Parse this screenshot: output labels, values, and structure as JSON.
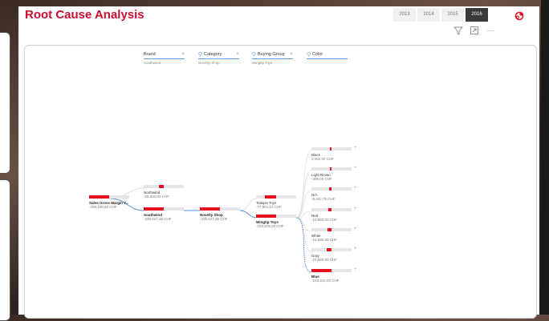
{
  "app": {
    "title": "Root Cause Analysis"
  },
  "years": [
    "2013",
    "2014",
    "2015",
    "2016"
  ],
  "active_year": "2016",
  "toolbar": {
    "filter_icon": "filter-icon",
    "focus_icon": "focus-mode-icon",
    "more_icon": "more-options-icon",
    "more_label": "···"
  },
  "fields": [
    {
      "label": "Brand",
      "value": "Southwind",
      "icon": "",
      "close": "×"
    },
    {
      "label": "Category",
      "value": "Novelty Shop",
      "icon": "lightbulb-icon",
      "close": "×"
    },
    {
      "label": "Buying Group",
      "value": "Wingtip Toys",
      "icon": "lightbulb-icon",
      "close": "×"
    },
    {
      "label": "Color",
      "value": "",
      "icon": "lightbulb-icon",
      "close": ""
    }
  ],
  "tree": {
    "root": {
      "name": "Sales Gross Margin Y...",
      "value": "-268,159,65 CHF",
      "fill": 0.5
    },
    "brand": [
      {
        "name": "Northwind",
        "value": "-29,532,00 CHF",
        "fill": 0.11,
        "selected": false
      },
      {
        "name": "Southwind",
        "value": "-239,627,35 CHF",
        "fill": 0.5,
        "selected": true
      }
    ],
    "category": [
      {
        "name": "Novelty Shop",
        "value": "-239,627,35 CHF",
        "fill": 0.5,
        "selected": true
      }
    ],
    "buying_group": [
      {
        "name": "Tailspin Toys",
        "value": "-77,951,10 CHF",
        "fill": 0.28,
        "selected": false
      },
      {
        "name": "Wingtip Toys",
        "value": "-152,876,25 CHF",
        "fill": 0.5,
        "selected": true
      }
    ],
    "color": [
      {
        "name": "Black",
        "value": "2,402,00 CHF",
        "fill": 0.02,
        "selected": false
      },
      {
        "name": "Light Brown",
        "value": "-396,00 CHF",
        "fill": 0.02,
        "selected": false
      },
      {
        "name": "N/A",
        "value": "-8,002,75 CHF",
        "fill": 0.06,
        "selected": false
      },
      {
        "name": "Red",
        "value": "-10,860,00 CHF",
        "fill": 0.08,
        "selected": false
      },
      {
        "name": "White",
        "value": "-12,585,00 CHF",
        "fill": 0.09,
        "selected": false
      },
      {
        "name": "Gray",
        "value": "-16,588,50 CHF",
        "fill": 0.12,
        "selected": false
      },
      {
        "name": "Blue",
        "value": "-103,316,00 CHF",
        "fill": 0.5,
        "selected": true
      }
    ],
    "plus_label": "+"
  },
  "colors": {
    "accent": "#e81123",
    "title": "#c8102e",
    "link": "#4a8fd9",
    "link_muted": "#dddddd"
  }
}
